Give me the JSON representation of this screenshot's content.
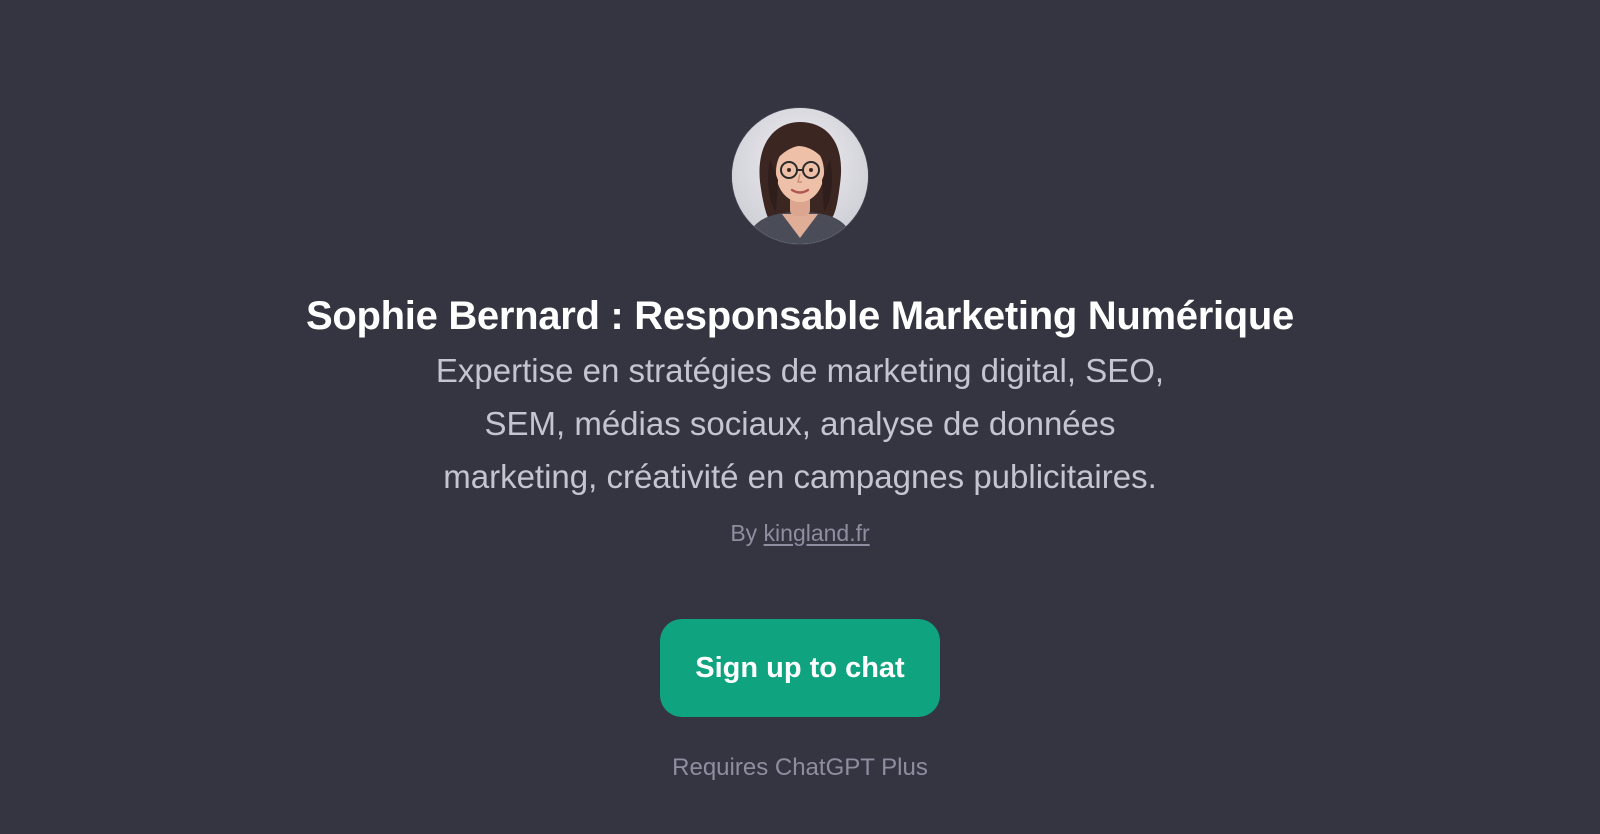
{
  "gpt": {
    "avatar_icon": "woman-portrait-avatar",
    "title": "Sophie Bernard : Responsable Marketing Numérique",
    "description_lines": [
      "Expertise en stratégies de marketing digital, SEO,",
      "SEM, médias sociaux, analyse de données",
      "marketing, créativité en campagnes publicitaires."
    ],
    "author_prefix": "By",
    "author_name": "kingland.fr"
  },
  "actions": {
    "signup_label": "Sign up to chat",
    "requirement": "Requires ChatGPT Plus"
  },
  "colors": {
    "background": "#343541",
    "accent": "#10a37f",
    "title": "#ffffff",
    "body_text": "#c5c5d2",
    "muted_text": "#8e8ea0"
  }
}
